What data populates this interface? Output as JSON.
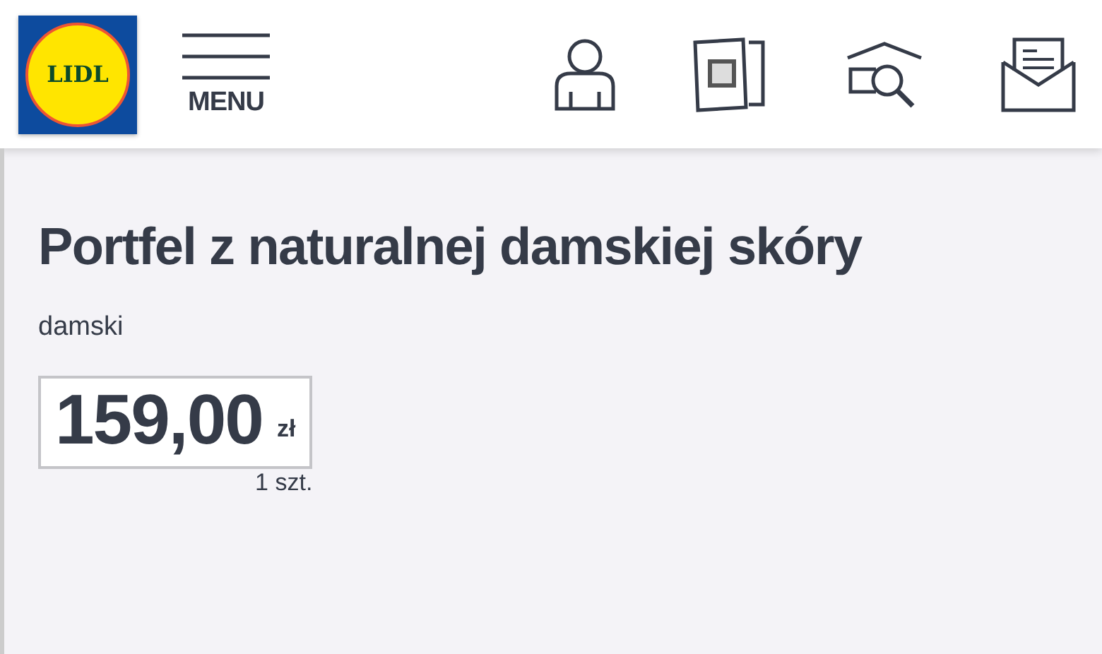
{
  "header": {
    "logo_text": "LIDL",
    "menu_label": "MENU"
  },
  "product": {
    "title": "Portfel z naturalnej damskiej skóry",
    "subtitle": "damski",
    "price": "159,00",
    "currency": "zł",
    "unit": "1 szt."
  }
}
